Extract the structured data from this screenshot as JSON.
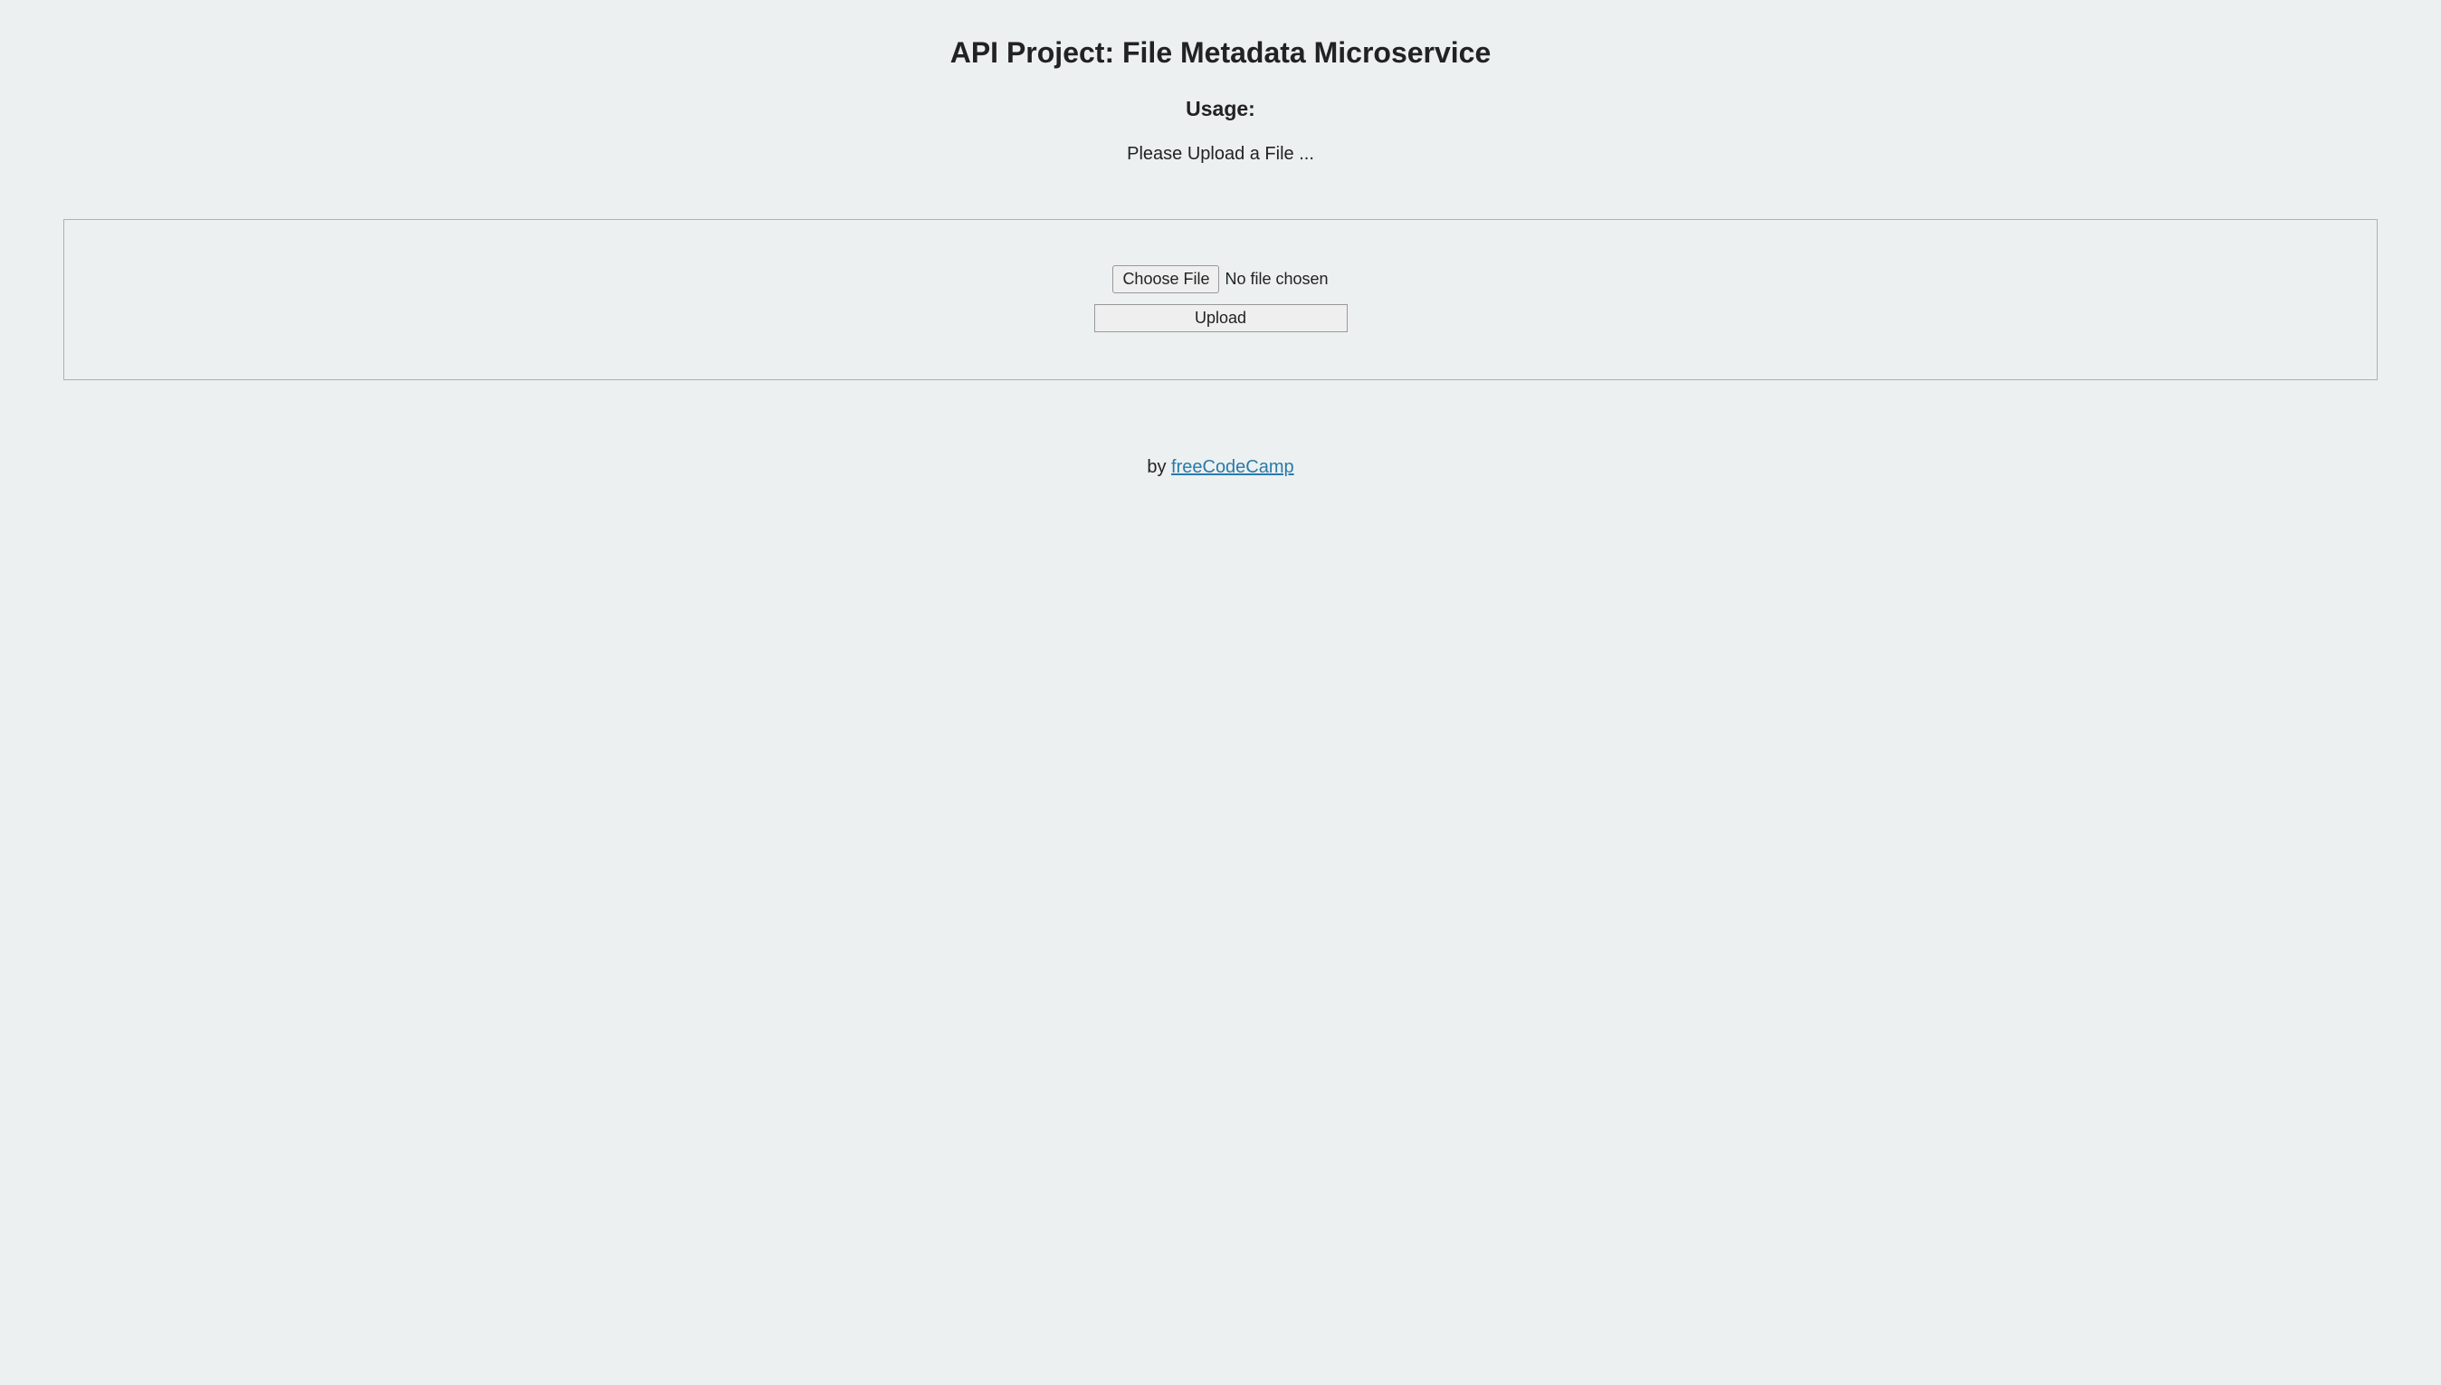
{
  "header": {
    "title": "API Project: File Metadata Microservice",
    "subtitle": "Usage:",
    "instruction": "Please Upload a File ..."
  },
  "form": {
    "choose_file_label": "Choose File",
    "file_status": "No file chosen",
    "upload_label": "Upload"
  },
  "footer": {
    "by_text": "by ",
    "link_text": "freeCodeCamp"
  }
}
